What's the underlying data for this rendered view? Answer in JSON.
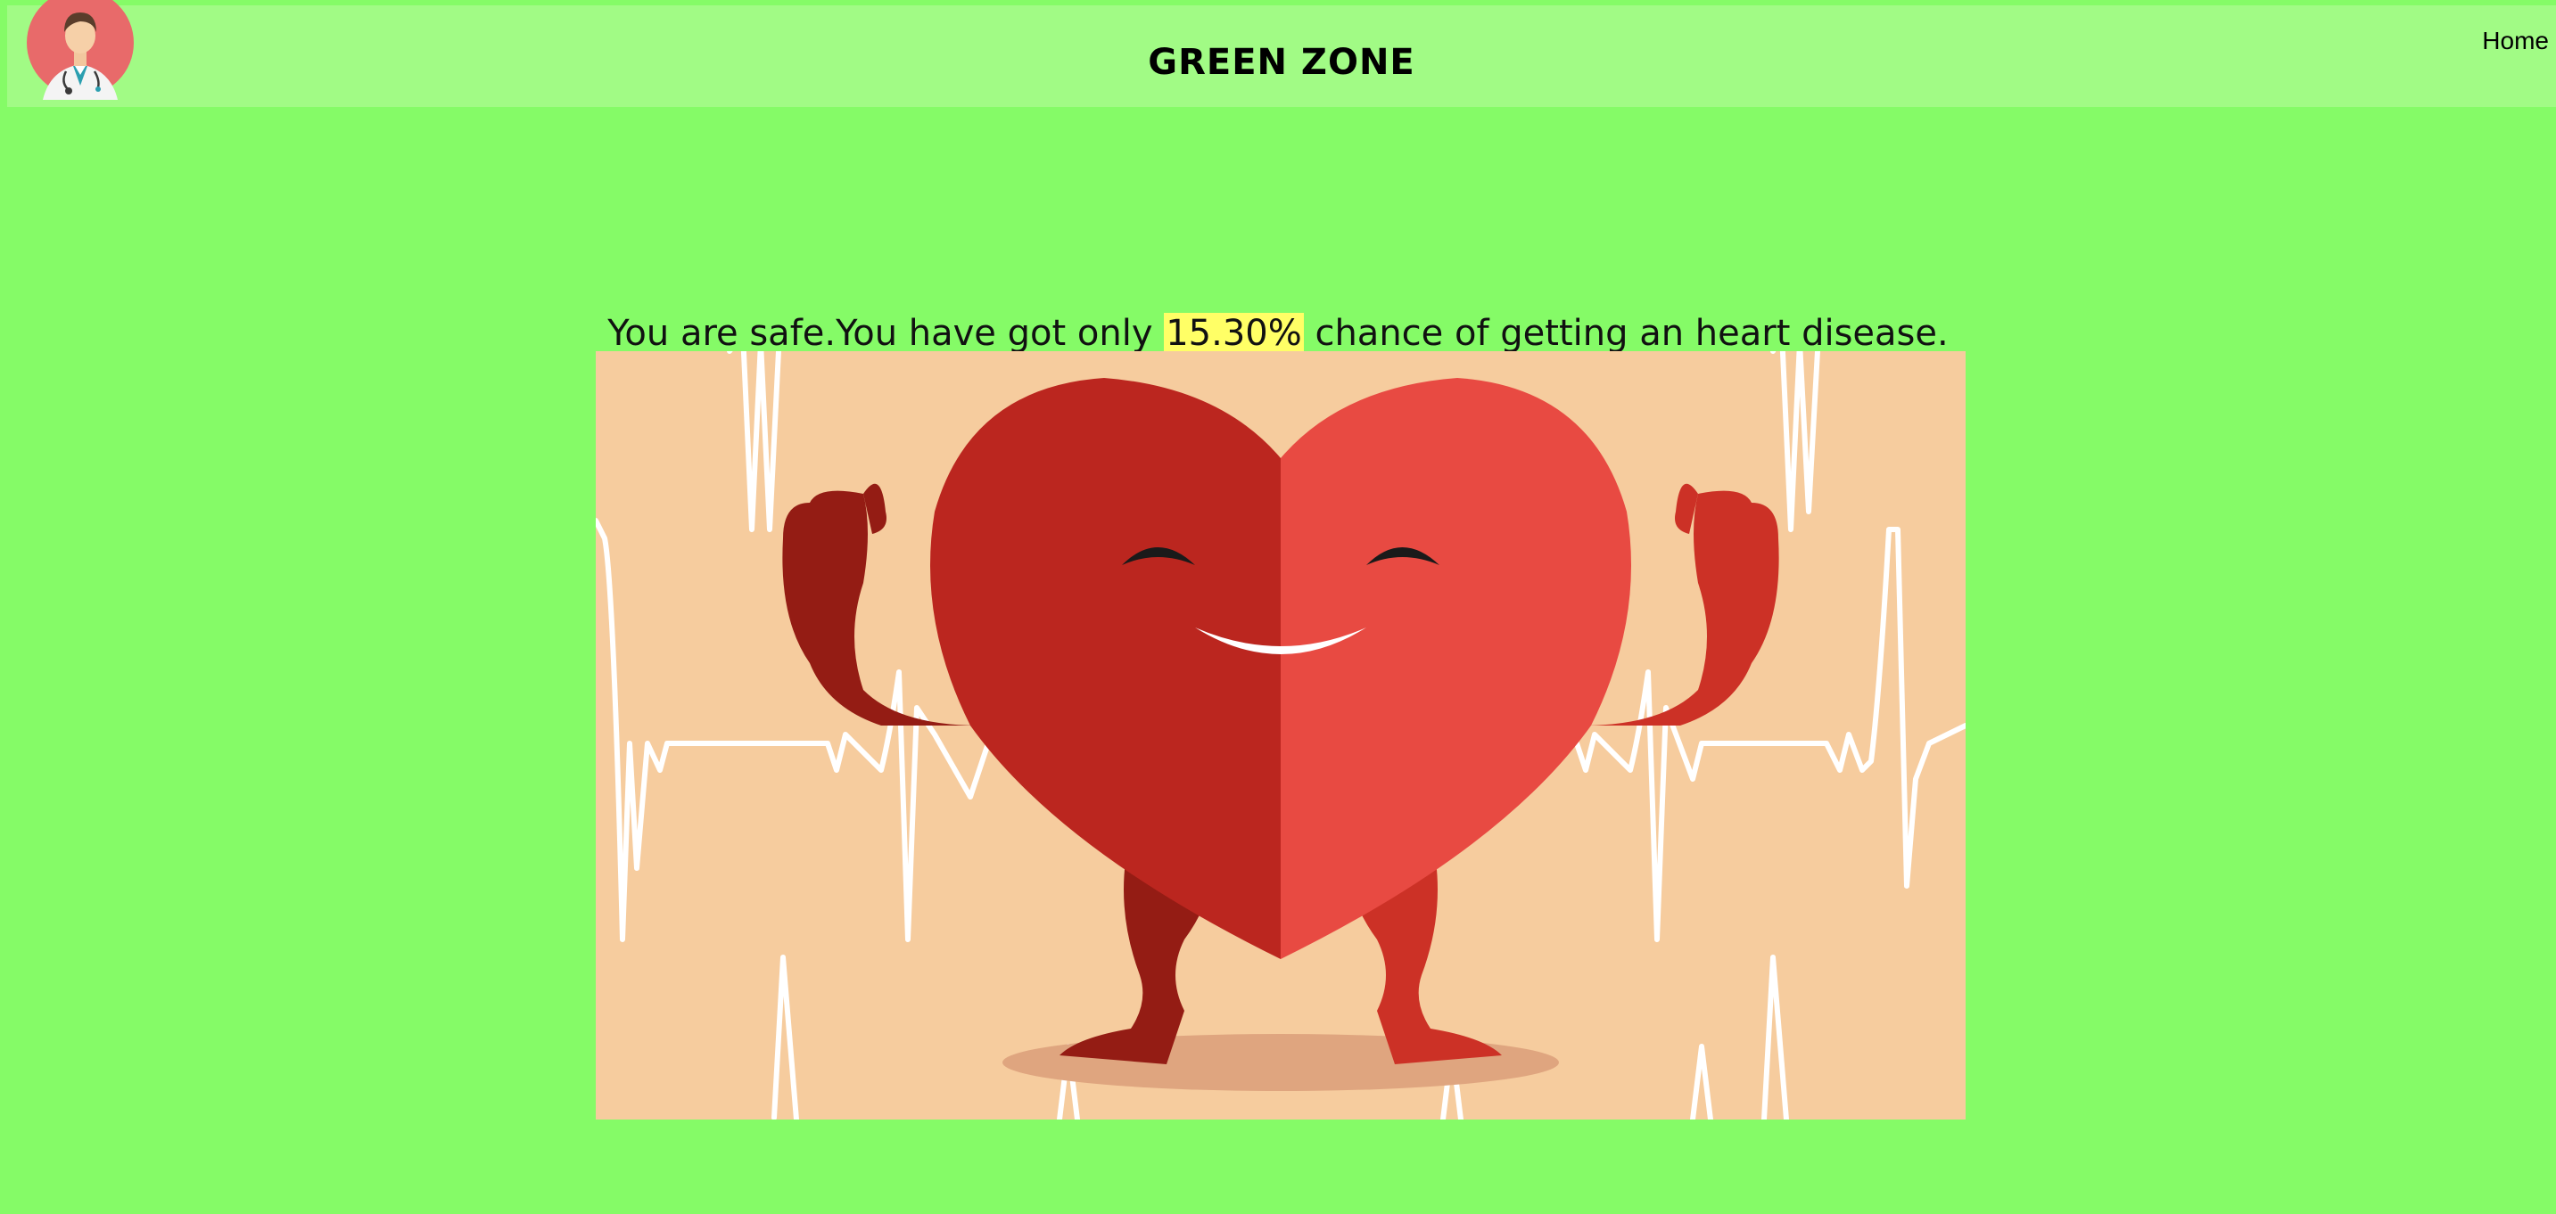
{
  "header": {
    "title": "GREEN ZONE",
    "nav_home": "Home",
    "avatar_icon": "doctor-avatar-icon"
  },
  "result": {
    "prefix": "You are safe.You have got only ",
    "percentage": "15.30%",
    "suffix": " chance of getting an heart disease."
  },
  "image": {
    "subject": "strong-heart-illustration-icon"
  },
  "colors": {
    "page_background": "#85fb67",
    "navbar_background": "#a1fb85",
    "highlight": "#ffff66",
    "hero_background": "#f6cc9e",
    "heart_left": "#bb261f",
    "heart_right": "#e84a42"
  }
}
